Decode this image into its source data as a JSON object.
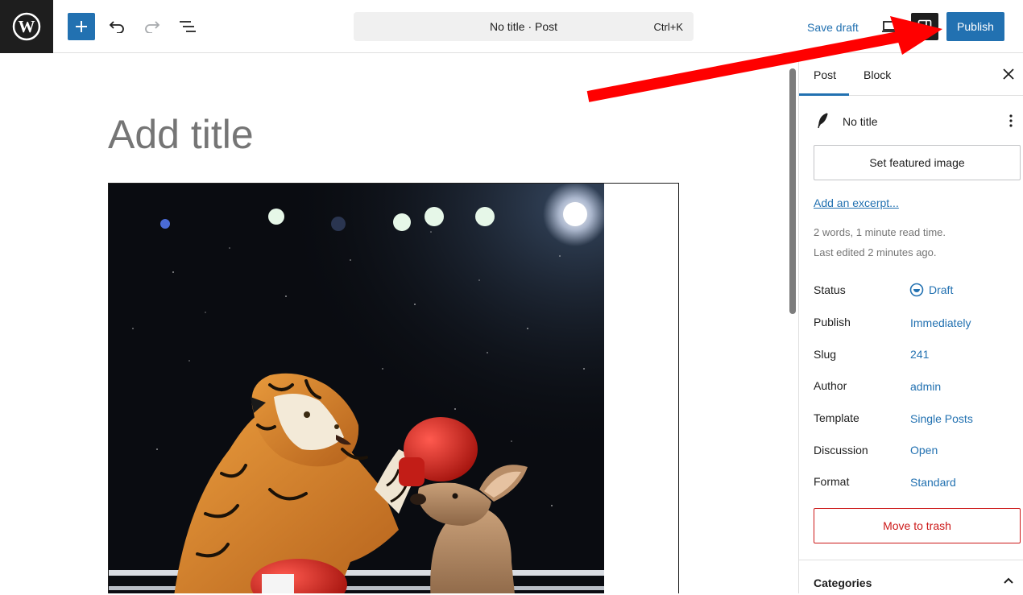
{
  "topbar": {
    "command_title": "No title · Post",
    "command_shortcut": "Ctrl+K",
    "save_draft": "Save draft",
    "publish": "Publish"
  },
  "editor": {
    "title_placeholder": "Add title"
  },
  "sidebar": {
    "tabs": [
      "Post",
      "Block"
    ],
    "active_tab": "Post",
    "post_title": "No title",
    "featured_image": "Set featured image",
    "excerpt_link": "Add an excerpt...",
    "meta_words": "2 words, 1 minute read time.",
    "meta_edited": "Last edited 2 minutes ago.",
    "fields": [
      {
        "label": "Status",
        "value": "Draft"
      },
      {
        "label": "Publish",
        "value": "Immediately"
      },
      {
        "label": "Slug",
        "value": "241"
      },
      {
        "label": "Author",
        "value": "admin"
      },
      {
        "label": "Template",
        "value": "Single Posts"
      },
      {
        "label": "Discussion",
        "value": "Open"
      },
      {
        "label": "Format",
        "value": "Standard"
      }
    ],
    "trash": "Move to trash",
    "categories": "Categories"
  },
  "colors": {
    "accent": "#2271b1",
    "danger": "#cc1818",
    "annotation_arrow": "#ff0000"
  },
  "icons": [
    "wordpress-logo-icon",
    "plus-icon",
    "undo-icon",
    "redo-icon",
    "document-overview-icon",
    "desktop-preview-icon",
    "settings-panel-icon",
    "close-icon",
    "quill-icon",
    "kebab-menu-icon",
    "draft-status-icon",
    "chevron-up-icon"
  ]
}
